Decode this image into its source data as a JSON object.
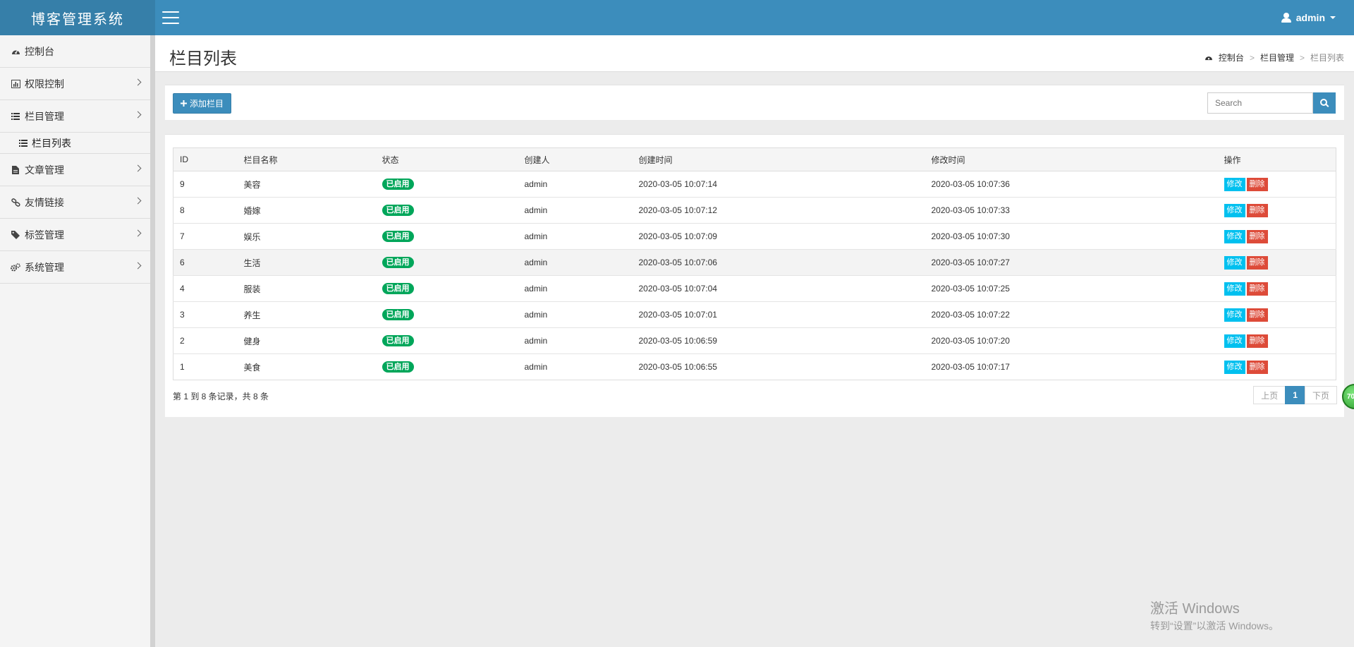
{
  "header": {
    "app_title": "博客管理系统",
    "user_name": "admin"
  },
  "sidebar": {
    "items": [
      {
        "label": "控制台",
        "icon": "dashboard-icon"
      },
      {
        "label": "权限控制",
        "icon": "bar-chart-icon"
      },
      {
        "label": "栏目管理",
        "icon": "list-icon"
      },
      {
        "label": "文章管理",
        "icon": "file-icon"
      },
      {
        "label": "友情链接",
        "icon": "link-icon"
      },
      {
        "label": "标签管理",
        "icon": "tag-icon"
      },
      {
        "label": "系统管理",
        "icon": "gears-icon"
      }
    ],
    "sub_item": {
      "label": "栏目列表",
      "icon": "list-icon"
    }
  },
  "page": {
    "title": "栏目列表",
    "breadcrumb": [
      "控制台",
      "栏目管理",
      "栏目列表"
    ],
    "breadcrumb_sep": ">"
  },
  "toolbar": {
    "add_label": "添加栏目",
    "search_placeholder": "Search"
  },
  "table": {
    "columns": [
      "ID",
      "栏目名称",
      "状态",
      "创建人",
      "创建时间",
      "修改时间",
      "操作"
    ],
    "edit_label": "修改",
    "delete_label": "删除",
    "rows": [
      {
        "id": "9",
        "name": "美容",
        "status": "已启用",
        "creator": "admin",
        "created": "2020-03-05 10:07:14",
        "modified": "2020-03-05 10:07:36"
      },
      {
        "id": "8",
        "name": "婚嫁",
        "status": "已启用",
        "creator": "admin",
        "created": "2020-03-05 10:07:12",
        "modified": "2020-03-05 10:07:33"
      },
      {
        "id": "7",
        "name": "娱乐",
        "status": "已启用",
        "creator": "admin",
        "created": "2020-03-05 10:07:09",
        "modified": "2020-03-05 10:07:30"
      },
      {
        "id": "6",
        "name": "生活",
        "status": "已启用",
        "creator": "admin",
        "created": "2020-03-05 10:07:06",
        "modified": "2020-03-05 10:07:27"
      },
      {
        "id": "4",
        "name": "服装",
        "status": "已启用",
        "creator": "admin",
        "created": "2020-03-05 10:07:04",
        "modified": "2020-03-05 10:07:25"
      },
      {
        "id": "3",
        "name": "养生",
        "status": "已启用",
        "creator": "admin",
        "created": "2020-03-05 10:07:01",
        "modified": "2020-03-05 10:07:22"
      },
      {
        "id": "2",
        "name": "健身",
        "status": "已启用",
        "creator": "admin",
        "created": "2020-03-05 10:06:59",
        "modified": "2020-03-05 10:07:20"
      },
      {
        "id": "1",
        "name": "美食",
        "status": "已启用",
        "creator": "admin",
        "created": "2020-03-05 10:06:55",
        "modified": "2020-03-05 10:07:17"
      }
    ],
    "info": "第 1 到 8 条记录，共 8 条"
  },
  "pagination": {
    "prev_label": "上页",
    "current_page": "1",
    "next_label": "下页"
  },
  "float_ball": {
    "text": "70"
  },
  "watermark": {
    "title": "激活 Windows",
    "subtitle": "转到“设置”以激活 Windows。"
  },
  "colors": {
    "brand": "#3c8dbc",
    "logo_bg": "#367fa9",
    "status_green": "#00a65a",
    "edit_cyan": "#00c0ef",
    "delete_red": "#dd4b39"
  }
}
